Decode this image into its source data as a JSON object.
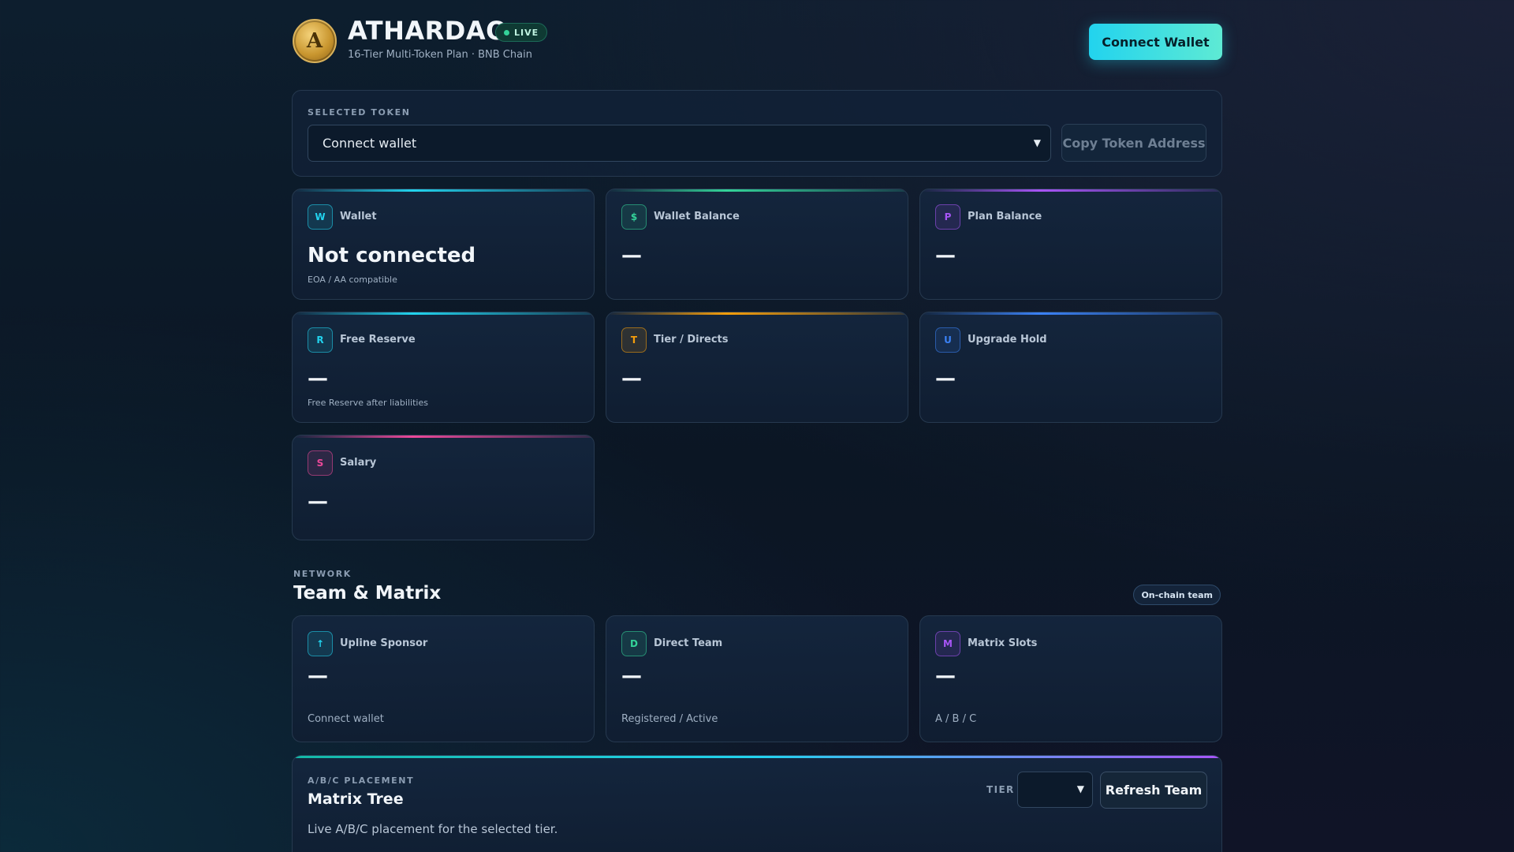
{
  "header": {
    "logo_text": "A",
    "title": "ATHARDAO",
    "live_badge": "LIVE",
    "subtitle": "16-Tier Multi-Token Plan · BNB Chain",
    "connect_button": "Connect Wallet"
  },
  "token": {
    "label": "SELECTED TOKEN",
    "select_value": "Connect wallet",
    "copy_button": "Copy Token Address"
  },
  "stats": [
    {
      "icon": "W",
      "label": "Wallet",
      "value": "Not connected",
      "sub": "EOA / AA compatible",
      "accent": "#22d3ee"
    },
    {
      "icon": "$",
      "label": "Wallet Balance",
      "value": "—",
      "sub": "",
      "accent": "#34d399"
    },
    {
      "icon": "P",
      "label": "Plan Balance",
      "value": "—",
      "sub": "",
      "accent": "#a855f7"
    },
    {
      "icon": "R",
      "label": "Free Reserve",
      "value": "—",
      "sub": "Free Reserve after liabilities",
      "accent": "#22d3ee"
    },
    {
      "icon": "T",
      "label": "Tier / Directs",
      "value": "—",
      "sub": "",
      "accent": "#f59e0b"
    },
    {
      "icon": "U",
      "label": "Upgrade Hold",
      "value": "—",
      "sub": "",
      "accent": "#3b82f6"
    },
    {
      "icon": "S",
      "label": "Salary",
      "value": "—",
      "sub": "",
      "accent": "#ec4899"
    }
  ],
  "network": {
    "eyebrow": "NETWORK",
    "title": "Team & Matrix",
    "pill": "On-chain team"
  },
  "team": [
    {
      "icon": "↑",
      "label": "Upline Sponsor",
      "value": "—",
      "sub": "Connect wallet",
      "accent": "#22d3ee"
    },
    {
      "icon": "D",
      "label": "Direct Team",
      "value": "—",
      "sub": "Registered / Active",
      "accent": "#34d399"
    },
    {
      "icon": "M",
      "label": "Matrix Slots",
      "value": "—",
      "sub": "A / B / C",
      "accent": "#a855f7"
    }
  ],
  "matrix": {
    "eyebrow": "A/B/C PLACEMENT",
    "title": "Matrix Tree",
    "description": "Live A/B/C placement for the selected tier.",
    "tier_label": "TIER",
    "tier_value": "",
    "refresh_button": "Refresh Team"
  }
}
